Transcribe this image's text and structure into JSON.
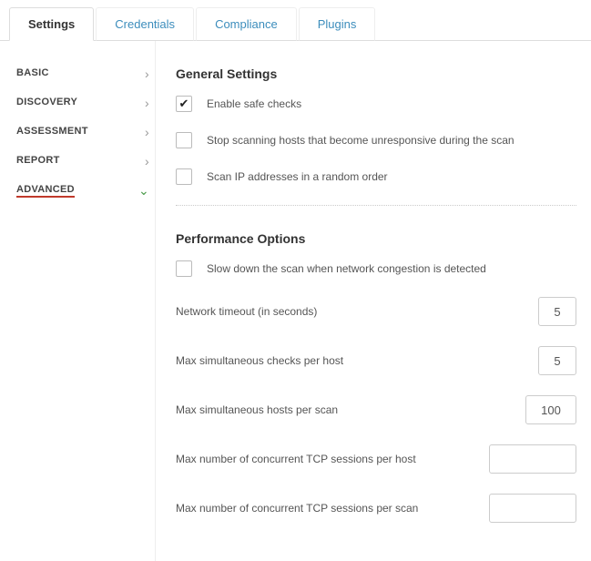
{
  "tabs": {
    "settings": "Settings",
    "credentials": "Credentials",
    "compliance": "Compliance",
    "plugins": "Plugins"
  },
  "sidebar": {
    "items": [
      {
        "label": "BASIC"
      },
      {
        "label": "DISCOVERY"
      },
      {
        "label": "ASSESSMENT"
      },
      {
        "label": "REPORT"
      },
      {
        "label": "ADVANCED"
      }
    ]
  },
  "general": {
    "heading": "General Settings",
    "safe_checks": "Enable safe checks",
    "stop_unresponsive": "Stop scanning hosts that become unresponsive during the scan",
    "random_order": "Scan IP addresses in a random order"
  },
  "perf": {
    "heading": "Performance Options",
    "slow_down": "Slow down the scan when network congestion is detected",
    "network_timeout_label": "Network timeout (in seconds)",
    "network_timeout_value": "5",
    "max_checks_label": "Max simultaneous checks per host",
    "max_checks_value": "5",
    "max_hosts_label": "Max simultaneous hosts per scan",
    "max_hosts_value": "100",
    "tcp_per_host_label": "Max number of concurrent TCP sessions per host",
    "tcp_per_host_value": "",
    "tcp_per_scan_label": "Max number of concurrent TCP sessions per scan",
    "tcp_per_scan_value": ""
  }
}
